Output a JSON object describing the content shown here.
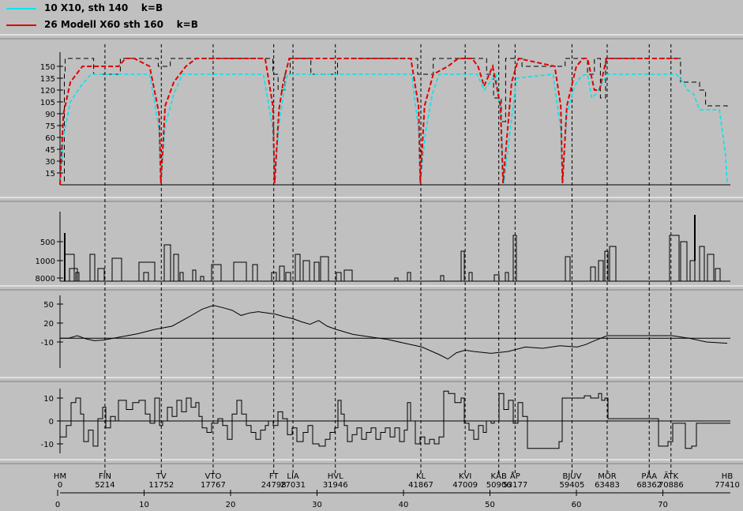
{
  "legend": {
    "series": [
      {
        "label": "10 X10, sth 140    k=B",
        "color": "#00e5ee"
      },
      {
        "label": "26 Modell X60 sth 160    k=B",
        "color": "#e00000"
      }
    ]
  },
  "colors": {
    "background": "#c0c0c0",
    "axis": "#000000",
    "limit": "#000000"
  },
  "chart_data": [
    {
      "type": "line",
      "name": "speed-panel",
      "yticks": [
        15,
        30,
        45,
        60,
        75,
        90,
        105,
        120,
        135,
        150
      ],
      "ylim": [
        0,
        170
      ],
      "xlim": [
        0,
        77410
      ],
      "series": [
        {
          "name": "limit",
          "style": "dashed",
          "color": "#000000",
          "x": [
            0,
            500,
            600,
            3800,
            3900,
            6800,
            7000,
            11200,
            11400,
            12600,
            12800,
            24400,
            24700,
            25300,
            26100,
            26700,
            28800,
            29100,
            31800,
            32200,
            41200,
            41500,
            43000,
            43300,
            48500,
            49500,
            50300,
            51200,
            51700,
            53400,
            53600,
            58200,
            58600,
            60500,
            61200,
            62000,
            62700,
            63300,
            63700,
            71400,
            72000,
            74200,
            74900,
            77410
          ],
          "y": [
            0,
            140,
            160,
            160,
            140,
            140,
            160,
            160,
            150,
            150,
            160,
            160,
            140,
            120,
            140,
            160,
            160,
            140,
            140,
            160,
            160,
            140,
            140,
            160,
            160,
            140,
            110,
            80,
            160,
            160,
            150,
            150,
            160,
            160,
            140,
            160,
            110,
            160,
            160,
            160,
            130,
            120,
            100,
            95
          ]
        },
        {
          "name": "10 X10, sth 140",
          "color": "#00e5ee",
          "x": [
            0,
            400,
            1200,
            2400,
            3600,
            10400,
            11500,
            11700,
            12200,
            13200,
            14200,
            23600,
            24700,
            24900,
            25400,
            26000,
            26400,
            28200,
            29000,
            32000,
            40800,
            41600,
            41800,
            42400,
            43200,
            44000,
            48400,
            49200,
            50600,
            51200,
            51500,
            52300,
            53000,
            57200,
            58100,
            58300,
            58800,
            59700,
            60500,
            61200,
            61700,
            62200,
            63500,
            65000,
            71500,
            72300,
            72800,
            73500,
            74200,
            75200,
            76500,
            77200,
            77400
          ],
          "y": [
            0,
            60,
            105,
            125,
            140,
            140,
            70,
            2,
            75,
            115,
            140,
            140,
            70,
            2,
            75,
            120,
            140,
            140,
            140,
            140,
            140,
            70,
            2,
            65,
            115,
            140,
            140,
            120,
            140,
            80,
            2,
            75,
            135,
            140,
            70,
            2,
            90,
            125,
            138,
            140,
            110,
            115,
            140,
            140,
            140,
            130,
            120,
            115,
            95,
            95,
            95,
            40,
            2
          ]
        },
        {
          "name": "26 Modell X60 sth 160",
          "color": "#e00000",
          "x": [
            0,
            400,
            1200,
            2600,
            4000,
            6800,
            7600,
            8600,
            10400,
            11500,
            11700,
            12200,
            13200,
            14600,
            15800,
            16600,
            18200,
            23800,
            24700,
            24900,
            25400,
            25900,
            26600,
            27400,
            28700,
            31800,
            32400,
            33400,
            40700,
            41600,
            41800,
            42300,
            43300,
            45000,
            46200,
            47000,
            47800,
            48500,
            49200,
            50200,
            51100,
            51400,
            52400,
            53200,
            57400,
            58100,
            58300,
            58800,
            59900,
            60700,
            61200,
            62000,
            62600,
            63400,
            71600
          ],
          "y": [
            0,
            90,
            130,
            150,
            150,
            150,
            160,
            160,
            150,
            90,
            2,
            100,
            130,
            150,
            160,
            160,
            160,
            160,
            100,
            2,
            95,
            130,
            160,
            160,
            160,
            160,
            160,
            160,
            160,
            100,
            2,
            100,
            140,
            150,
            160,
            160,
            160,
            150,
            125,
            150,
            100,
            2,
            130,
            160,
            150,
            100,
            2,
            100,
            150,
            160,
            160,
            120,
            120,
            160,
            160
          ]
        }
      ]
    },
    {
      "type": "bar",
      "name": "radius-panel",
      "yticks": [
        500,
        1000,
        8000
      ],
      "xlim": [
        0,
        77410
      ]
    },
    {
      "type": "line",
      "name": "altitude-panel",
      "yticks": [
        50,
        20,
        -10
      ],
      "ylim": [
        -30,
        60
      ],
      "xlim": [
        0,
        77410
      ],
      "series": [
        {
          "name": "altitude",
          "x": [
            0,
            1000,
            2000,
            3000,
            4000,
            5000,
            7000,
            9000,
            11000,
            13000,
            15000,
            16500,
            17800,
            19000,
            20000,
            21000,
            22000,
            23000,
            24000,
            25000,
            26000,
            27000,
            28000,
            29000,
            30000,
            31000,
            32000,
            34000,
            36000,
            38000,
            40000,
            42000,
            44000,
            45000,
            46000,
            47000,
            48000,
            50000,
            52000,
            54000,
            56000,
            58000,
            60000,
            61000,
            62000,
            63500,
            66000,
            69000,
            71000,
            73000,
            75000,
            77410
          ],
          "y": [
            -4,
            -4,
            0,
            -5,
            -8,
            -7,
            -2,
            3,
            10,
            15,
            30,
            42,
            48,
            44,
            40,
            32,
            36,
            38,
            36,
            34,
            30,
            27,
            22,
            18,
            24,
            15,
            10,
            2,
            -2,
            -6,
            -12,
            -18,
            -30,
            -37,
            -27,
            -23,
            -25,
            -28,
            -25,
            -18,
            -20,
            -16,
            -18,
            -14,
            -8,
            0,
            0,
            0,
            0,
            -4,
            -10,
            -12
          ]
        }
      ]
    },
    {
      "type": "bar",
      "name": "gradient-panel",
      "yticks": [
        10,
        0,
        -10
      ],
      "ylim": [
        -15,
        15
      ],
      "xlim": [
        0,
        77410
      ]
    },
    {
      "type": "table",
      "name": "stations-axis",
      "stations": [
        {
          "code": "HM",
          "km": "0",
          "x": 0
        },
        {
          "code": "FIN",
          "km": "5214",
          "x": 5214
        },
        {
          "code": "TV",
          "km": "11752",
          "x": 11752
        },
        {
          "code": "VTO",
          "km": "17767",
          "x": 17767
        },
        {
          "code": "FT",
          "km": "24798",
          "x": 24798
        },
        {
          "code": "LIA",
          "km": "27031",
          "x": 27031
        },
        {
          "code": "HVL",
          "km": "31946",
          "x": 31946
        },
        {
          "code": "KL",
          "km": "41867",
          "x": 41867
        },
        {
          "code": "KVI",
          "km": "47009",
          "x": 47009
        },
        {
          "code": "KÅB",
          "km": "50906",
          "x": 50906
        },
        {
          "code": "ÅP",
          "km": "53177",
          "x": 52800
        },
        {
          "code": "BJUV",
          "km": "59405",
          "x": 59405
        },
        {
          "code": "MÖR",
          "km": "63483",
          "x": 63483
        },
        {
          "code": "PÅA",
          "km": "68362",
          "x": 68362
        },
        {
          "code": "ÄTK",
          "km": "70886",
          "x": 70886
        },
        {
          "code": "HB",
          "km": "77410",
          "x": 77410
        }
      ],
      "km_ticks": [
        "0",
        "10",
        "20",
        "30",
        "40",
        "50",
        "60",
        "70"
      ]
    }
  ]
}
